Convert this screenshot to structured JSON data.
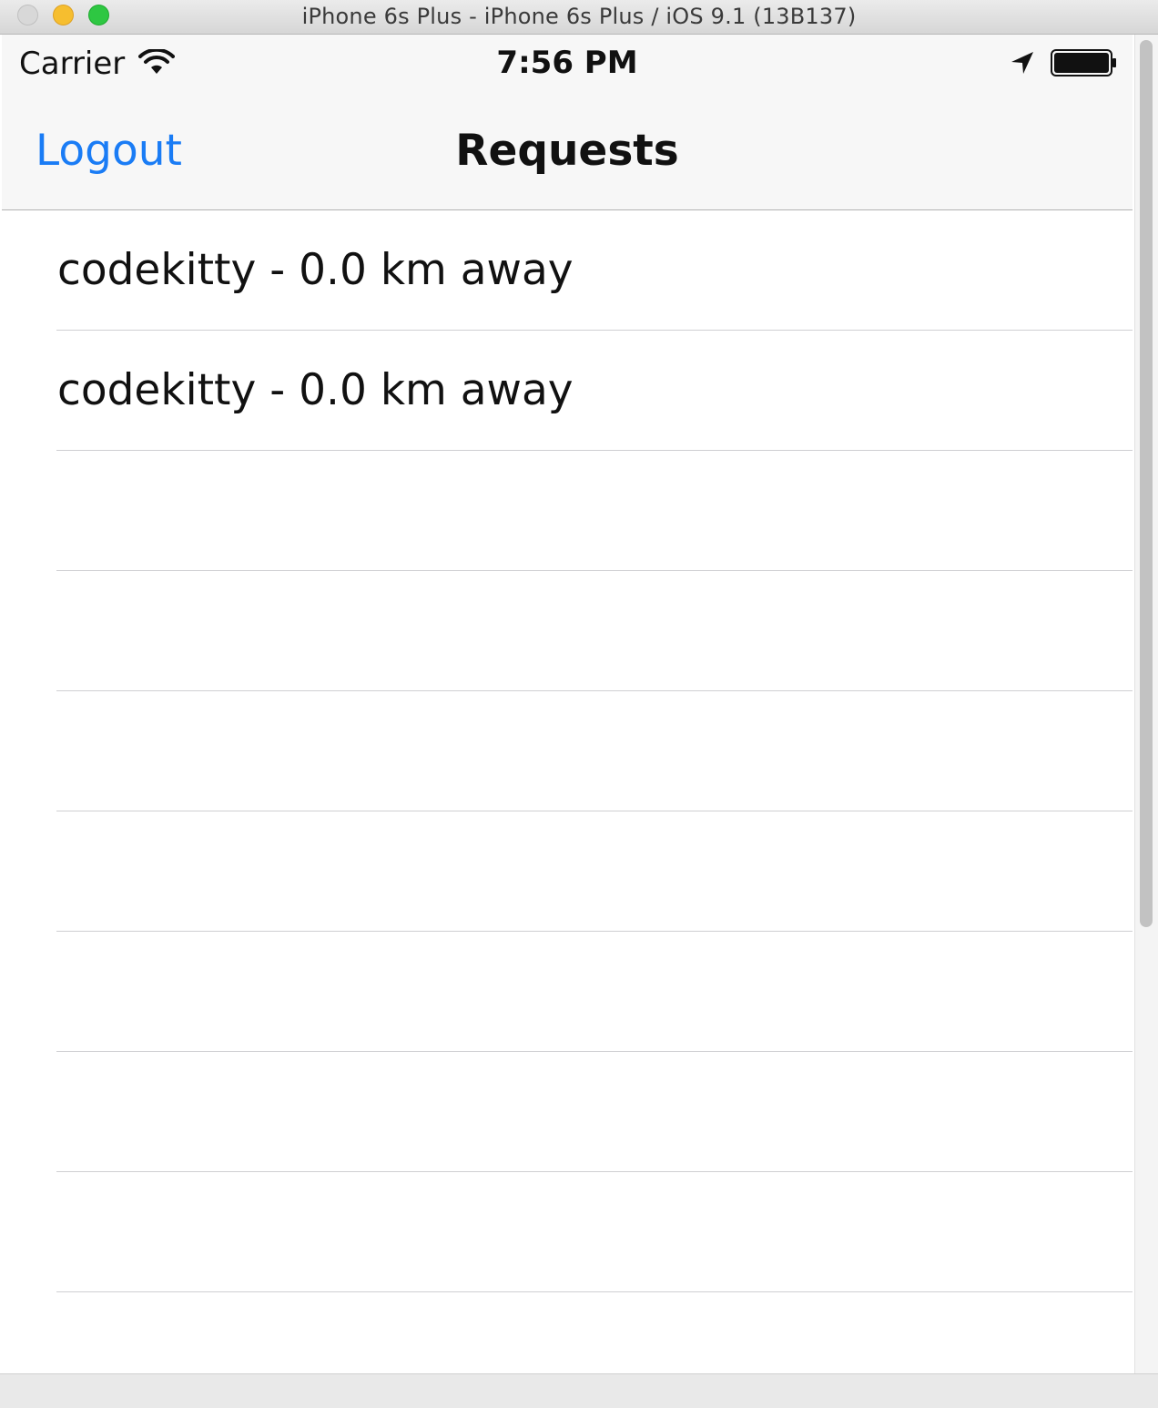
{
  "window": {
    "title": "iPhone 6s Plus - iPhone 6s Plus / iOS 9.1 (13B137)"
  },
  "status_bar": {
    "carrier": "Carrier",
    "time": "7:56 PM",
    "icons": [
      "wifi-icon",
      "location-arrow-icon",
      "battery-icon"
    ]
  },
  "nav_bar": {
    "left_button": "Logout",
    "title": "Requests"
  },
  "table": {
    "rows": [
      {
        "label": "codekitty - 0.0 km away"
      },
      {
        "label": "codekitty - 0.0 km away"
      },
      {
        "label": ""
      },
      {
        "label": ""
      },
      {
        "label": ""
      },
      {
        "label": ""
      },
      {
        "label": ""
      },
      {
        "label": ""
      },
      {
        "label": ""
      }
    ]
  },
  "colors": {
    "tint": "#1a7cf5",
    "separator": "#cfcfd2",
    "bar_background": "#f7f7f7"
  }
}
